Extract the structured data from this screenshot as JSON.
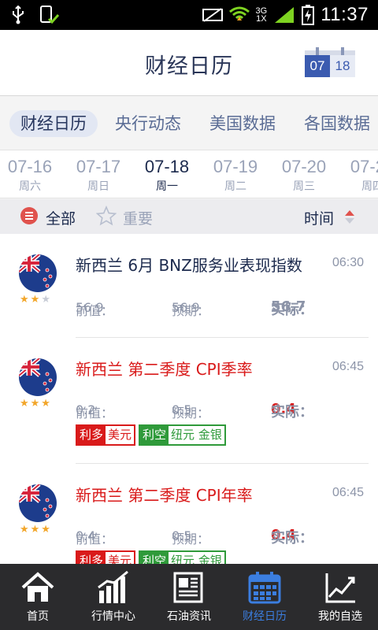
{
  "status_bar": {
    "time": "11:37",
    "network": "3G",
    "network_sub": "1X"
  },
  "header": {
    "title": "财经日历",
    "calendar_month": "07",
    "calendar_day": "18"
  },
  "category_tabs": [
    {
      "label": "财经日历",
      "active": true
    },
    {
      "label": "央行动态",
      "active": false
    },
    {
      "label": "美国数据",
      "active": false
    },
    {
      "label": "各国数据",
      "active": false
    }
  ],
  "dates": [
    {
      "date": "07-16",
      "weekday": "周六",
      "active": false
    },
    {
      "date": "07-17",
      "weekday": "周日",
      "active": false
    },
    {
      "date": "07-18",
      "weekday": "周一",
      "active": true
    },
    {
      "date": "07-19",
      "weekday": "周二",
      "active": false
    },
    {
      "date": "07-20",
      "weekday": "周三",
      "active": false
    },
    {
      "date": "07-21",
      "weekday": "周四",
      "active": false
    }
  ],
  "filter": {
    "all_label": "全部",
    "important_label": "重要",
    "time_label": "时间"
  },
  "events": [
    {
      "title": "新西兰 6月 BNZ服务业表现指数",
      "time": "06:30",
      "stars": 2,
      "previous_label": "前值：",
      "previous": "56.9",
      "forecast_label": "预期：",
      "forecast": "56.9",
      "actual_label": "实际：",
      "actual": "56.7",
      "highlight": false,
      "tags": []
    },
    {
      "title": "新西兰 第二季度 CPI季率",
      "time": "06:45",
      "stars": 3,
      "previous_label": "前值：",
      "previous": "0.2",
      "forecast_label": "预期：",
      "forecast": "0.5",
      "actual_label": "实际：",
      "actual": "0.4",
      "highlight": true,
      "tags": [
        {
          "type": "bull",
          "key": "利多",
          "value": "美元"
        },
        {
          "type": "bear",
          "key": "利空",
          "value": "纽元 金银"
        }
      ]
    },
    {
      "title": "新西兰 第二季度 CPI年率",
      "time": "06:45",
      "stars": 3,
      "previous_label": "前值：",
      "previous": "0.4",
      "forecast_label": "预期：",
      "forecast": "0.5",
      "actual_label": "实际：",
      "actual": "0.4",
      "highlight": true,
      "tags": [
        {
          "type": "bull",
          "key": "利多",
          "value": "美元"
        },
        {
          "type": "bear",
          "key": "利空",
          "value": "纽元 金银"
        }
      ]
    }
  ],
  "bottom_nav": [
    {
      "label": "首页",
      "icon": "home-icon",
      "active": false
    },
    {
      "label": "行情中心",
      "icon": "chart-bars-icon",
      "active": false
    },
    {
      "label": "石油资讯",
      "icon": "newspaper-icon",
      "active": false
    },
    {
      "label": "财经日历",
      "icon": "calendar-icon",
      "active": true
    },
    {
      "label": "我的自选",
      "icon": "trend-line-icon",
      "active": false
    }
  ],
  "colors": {
    "accent": "#3b5bb0",
    "bullish": "#d91a1a",
    "bearish": "#2f9a3a",
    "nav_active": "#3b7ee0"
  }
}
